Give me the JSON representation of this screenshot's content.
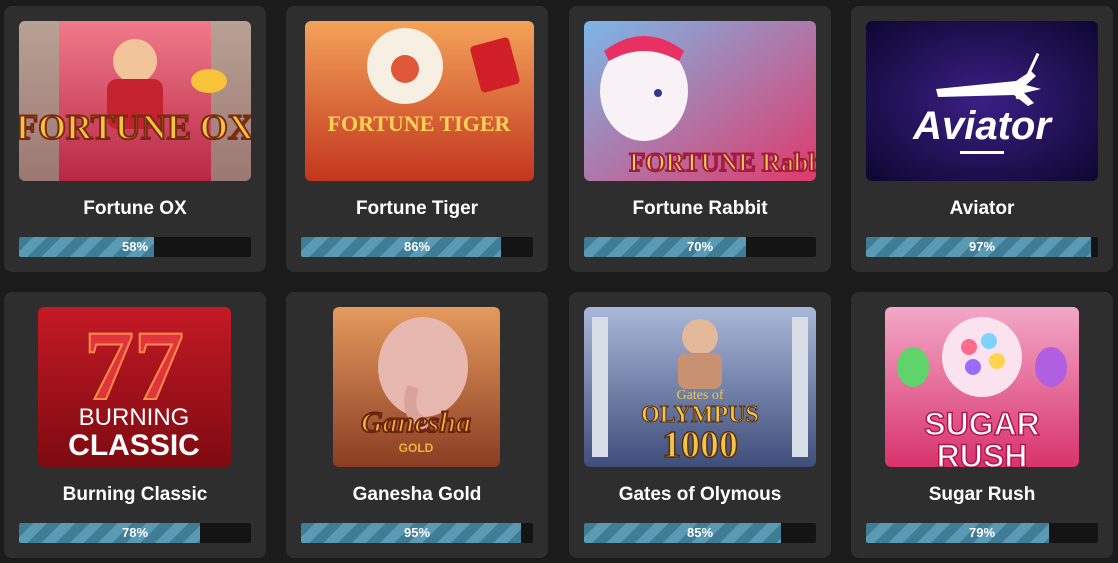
{
  "games": [
    {
      "title": "Fortune OX",
      "percent_label": "58%",
      "progress": 0.58,
      "logo_text": "FORTUNE OX",
      "colors": {
        "bg": "#d9465c",
        "accent": "#f6c33b"
      }
    },
    {
      "title": "Fortune Tiger",
      "percent_label": "86%",
      "progress": 0.86,
      "logo_text": "FORTUNE TIGER",
      "colors": {
        "bg": "#e8884a",
        "accent": "#ffd255"
      }
    },
    {
      "title": "Fortune Rabbit",
      "percent_label": "70%",
      "progress": 0.7,
      "logo_text": "FORTUNE Rabbit",
      "colors": {
        "bg": "#e05a8a",
        "accent": "#ffd34d"
      }
    },
    {
      "title": "Aviator",
      "percent_label": "97%",
      "progress": 0.97,
      "logo_text": "Aviator",
      "colors": {
        "bg": "#2a1660",
        "accent": "#ffffff"
      }
    },
    {
      "title": "Burning Classic",
      "percent_label": "78%",
      "progress": 0.78,
      "logo_text_top": "BURNING",
      "logo_text_bottom": "CLASSIC",
      "colors": {
        "bg": "#b5121d",
        "accent": "#ffffff"
      }
    },
    {
      "title": "Ganesha Gold",
      "percent_label": "95%",
      "progress": 0.95,
      "logo_text": "Ganesha",
      "logo_sub": "GOLD",
      "colors": {
        "bg": "#c86a3a",
        "accent": "#f2b23a"
      }
    },
    {
      "title": "Gates of Olymous",
      "percent_label": "85%",
      "progress": 0.85,
      "logo_text_top": "Gates of",
      "logo_text_mid": "OLYMPUS",
      "logo_text_bottom": "1000",
      "colors": {
        "bg": "#6a7fa8",
        "accent": "#f3c64b"
      }
    },
    {
      "title": "Sugar Rush",
      "percent_label": "79%",
      "progress": 0.79,
      "logo_text_top": "SUGAR",
      "logo_text_bottom": "RUSH",
      "colors": {
        "bg": "#e24b7f",
        "accent": "#ffffff"
      }
    }
  ]
}
